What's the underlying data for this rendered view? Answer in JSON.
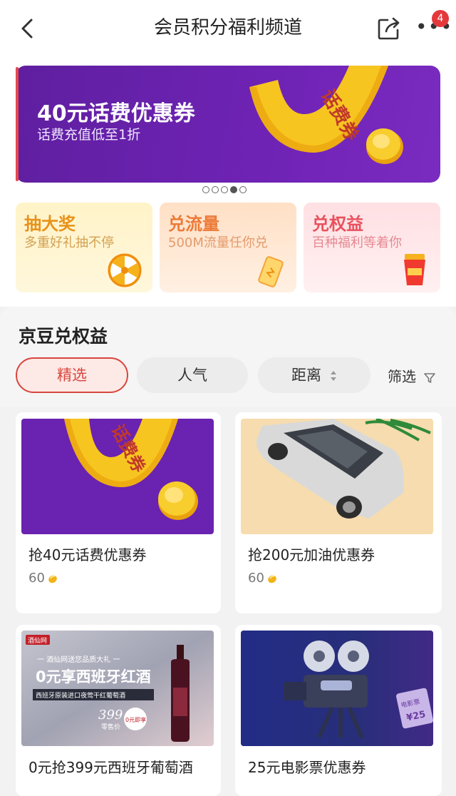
{
  "header": {
    "title": "会员积分福利频道",
    "badge_count": "4",
    "more_label": "•••",
    "icons": [
      "back-arrow-icon",
      "share-icon",
      "more-icon"
    ]
  },
  "banner": {
    "title": "40元话费优惠券",
    "subtitle": "话费充值低至1折",
    "art_text": "话费券",
    "carousel_total": 5,
    "carousel_active_index": 3
  },
  "quick_cards": [
    {
      "title": "抽大奖",
      "subtitle": "多重好礼抽不停",
      "icon": "lucky-wheel-icon",
      "color": "#e8921a"
    },
    {
      "title": "兑流量",
      "subtitle": "500M流量任你兑",
      "icon": "phone-icon",
      "color": "#ec7a37"
    },
    {
      "title": "兑权益",
      "subtitle": "百种福利等着你",
      "icon": "coffee-cup-icon",
      "color": "#e9505c"
    }
  ],
  "section": {
    "title": "京豆兑权益",
    "tabs": [
      {
        "label": "精选",
        "active": true
      },
      {
        "label": "人气",
        "active": false
      },
      {
        "label": "距离",
        "active": false
      }
    ],
    "filter_label": "筛选"
  },
  "products": [
    {
      "name": "抢40元话费优惠券",
      "points": "60",
      "image_text": "话费券"
    },
    {
      "name": "抢200元加油优惠券",
      "points": "60"
    },
    {
      "name": "0元抢399元西班牙葡萄酒",
      "image_text": {
        "logo": "酒仙网",
        "top": "一 酒仙网送您品质大礼 一",
        "headline": "0元享西班牙红酒",
        "desc": "西班牙原装进口夜莺干红葡萄酒",
        "price": "399",
        "price_caption": "零售价",
        "badge": "0元即享"
      }
    },
    {
      "name": "25元电影票优惠券",
      "image_text": {
        "ticket": "电影票",
        "amount": "¥25"
      }
    }
  ],
  "colors": {
    "accent": "#d9463e",
    "banner_purple": "#6a22b0",
    "gold": "#f6c21a",
    "badge_red": "#e4393c"
  }
}
